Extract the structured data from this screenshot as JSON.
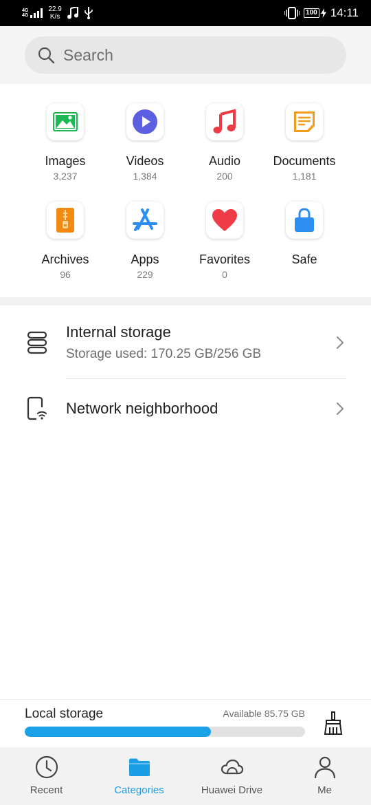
{
  "status_bar": {
    "network_type": "4G",
    "network_sub": "4G",
    "speed_value": "22.9",
    "speed_unit": "K/s",
    "battery": "100",
    "time": "14:11"
  },
  "search": {
    "placeholder": "Search"
  },
  "categories": [
    {
      "label": "Images",
      "count": "3,237",
      "icon": "image-icon",
      "color": "#1db954"
    },
    {
      "label": "Videos",
      "count": "1,384",
      "icon": "play-icon",
      "color": "#5b5fe0"
    },
    {
      "label": "Audio",
      "count": "200",
      "icon": "music-note-icon",
      "color": "#ef3b46"
    },
    {
      "label": "Documents",
      "count": "1,181",
      "icon": "document-icon",
      "color": "#f29c1f"
    },
    {
      "label": "Archives",
      "count": "96",
      "icon": "zip-icon",
      "color": "#f28a12"
    },
    {
      "label": "Apps",
      "count": "229",
      "icon": "app-store-icon",
      "color": "#2b8ef0"
    },
    {
      "label": "Favorites",
      "count": "0",
      "icon": "heart-icon",
      "color": "#ef3b46"
    },
    {
      "label": "Safe",
      "count": "",
      "icon": "lock-icon",
      "color": "#2b8ef0"
    }
  ],
  "storage_list": {
    "internal": {
      "title": "Internal storage",
      "subtitle": "Storage used: 170.25 GB/256 GB"
    },
    "network": {
      "title": "Network neighborhood"
    }
  },
  "local_storage": {
    "label": "Local storage",
    "available": "Available 85.75 GB",
    "used_fraction": 0.665,
    "bar_color": "#1aa1e8"
  },
  "bottom_nav": [
    {
      "label": "Recent",
      "icon": "clock-icon",
      "active": false
    },
    {
      "label": "Categories",
      "icon": "folder-icon",
      "active": true
    },
    {
      "label": "Huawei Drive",
      "icon": "cloud-icon",
      "active": false
    },
    {
      "label": "Me",
      "icon": "person-icon",
      "active": false
    }
  ],
  "colors": {
    "accent": "#1a9ee6"
  }
}
